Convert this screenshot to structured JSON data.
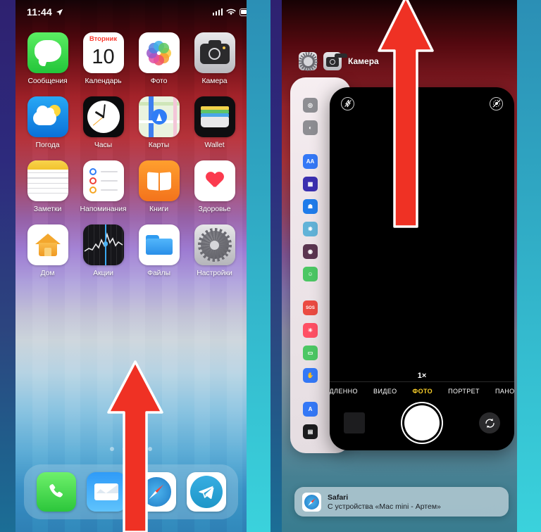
{
  "left_panel": {
    "status_bar": {
      "time": "11:44",
      "location_icon": "location-arrow-icon",
      "signal_icon": "cellular-signal-icon",
      "wifi_icon": "wifi-icon",
      "battery_icon": "battery-icon"
    },
    "home_apps": [
      {
        "label": "Сообщения",
        "icon": "messages-icon"
      },
      {
        "label": "Календарь",
        "icon": "calendar-icon",
        "weekday": "Вторник",
        "day": "10"
      },
      {
        "label": "Фото",
        "icon": "photos-icon"
      },
      {
        "label": "Камера",
        "icon": "camera-icon"
      },
      {
        "label": "Погода",
        "icon": "weather-icon"
      },
      {
        "label": "Часы",
        "icon": "clock-icon"
      },
      {
        "label": "Карты",
        "icon": "maps-icon"
      },
      {
        "label": "Wallet",
        "icon": "wallet-icon"
      },
      {
        "label": "Заметки",
        "icon": "notes-icon"
      },
      {
        "label": "Напоминания",
        "icon": "reminders-icon"
      },
      {
        "label": "Книги",
        "icon": "books-icon"
      },
      {
        "label": "Здоровье",
        "icon": "health-icon"
      },
      {
        "label": "Дом",
        "icon": "home-icon"
      },
      {
        "label": "Акции",
        "icon": "stocks-icon"
      },
      {
        "label": "Файлы",
        "icon": "files-icon"
      },
      {
        "label": "Настройки",
        "icon": "settings-icon"
      }
    ],
    "page_dots": {
      "count": 4,
      "active_index": 1
    },
    "dock": [
      {
        "label": "Телефон",
        "icon": "phone-icon"
      },
      {
        "label": "Почта",
        "icon": "mail-icon"
      },
      {
        "label": "Safari",
        "icon": "safari-icon"
      },
      {
        "label": "Telegram",
        "icon": "telegram-icon"
      }
    ],
    "gesture": {
      "icon": "swipe-up-arrow-icon",
      "color": "#ef3124"
    }
  },
  "right_panel": {
    "switcher_header": [
      {
        "label": "",
        "icon": "settings-icon"
      },
      {
        "label": "Камера",
        "icon": "camera-icon"
      }
    ],
    "settings_card": {
      "name": "settings-app-card",
      "rows": [
        {
          "icon": "control-center-icon",
          "color": "#8e8e93",
          "glyph": "◎"
        },
        {
          "icon": "display-brightness-icon",
          "color": "#8e8e93",
          "glyph": "◐"
        },
        {
          "icon": "text-size-icon",
          "color": "#3478f6",
          "glyph": "AA"
        },
        {
          "icon": "home-screen-icon",
          "color": "#3b2fb0",
          "glyph": "▦"
        },
        {
          "icon": "accessibility-icon",
          "color": "#1f7ceb",
          "glyph": "☗"
        },
        {
          "icon": "wallpaper-icon",
          "color": "#62b3d8",
          "glyph": "❋"
        },
        {
          "icon": "siri-search-icon",
          "color": "#5b3550",
          "glyph": "◉"
        },
        {
          "icon": "face-id-icon",
          "color": "#4cc764",
          "glyph": "☺"
        },
        {
          "icon": "sos-icon",
          "color": "#eb4b42",
          "glyph": "SOS"
        },
        {
          "icon": "exposure-notifications-icon",
          "color": "#ff4f64",
          "glyph": "✳"
        },
        {
          "icon": "battery-settings-icon",
          "color": "#4cc764",
          "glyph": "▭"
        },
        {
          "icon": "privacy-hand-icon",
          "color": "#3478f6",
          "glyph": "✋"
        },
        {
          "icon": "app-store-icon",
          "color": "#3478f6",
          "glyph": "A"
        },
        {
          "icon": "wallet-settings-icon",
          "color": "#1c1c1e",
          "glyph": "▤"
        },
        {
          "icon": "passwords-key-icon",
          "color": "#8e8e93",
          "glyph": "⚿"
        }
      ]
    },
    "camera_card": {
      "name": "camera-app-card",
      "flash_icon": "flash-off-icon",
      "live_photo_icon": "live-photo-off-icon",
      "zoom_label": "1×",
      "modes": [
        {
          "label": "ЗАМЕДЛЕННО",
          "active": false
        },
        {
          "label": "ВИДЕО",
          "active": false
        },
        {
          "label": "ФОТО",
          "active": true
        },
        {
          "label": "ПОРТРЕТ",
          "active": false
        },
        {
          "label": "ПАНОРАМА",
          "active": false
        }
      ],
      "active_mode_color": "#fcd12a",
      "gallery_thumb": "gallery-thumbnail",
      "shutter": "shutter-button",
      "flip_icon": "flip-camera-icon"
    },
    "handoff": {
      "app_icon": "safari-icon",
      "title": "Safari",
      "subtitle": "С устройства «Mac mini - Артем»"
    },
    "gesture": {
      "icon": "swipe-up-arrow-icon",
      "color": "#ef3124"
    }
  }
}
